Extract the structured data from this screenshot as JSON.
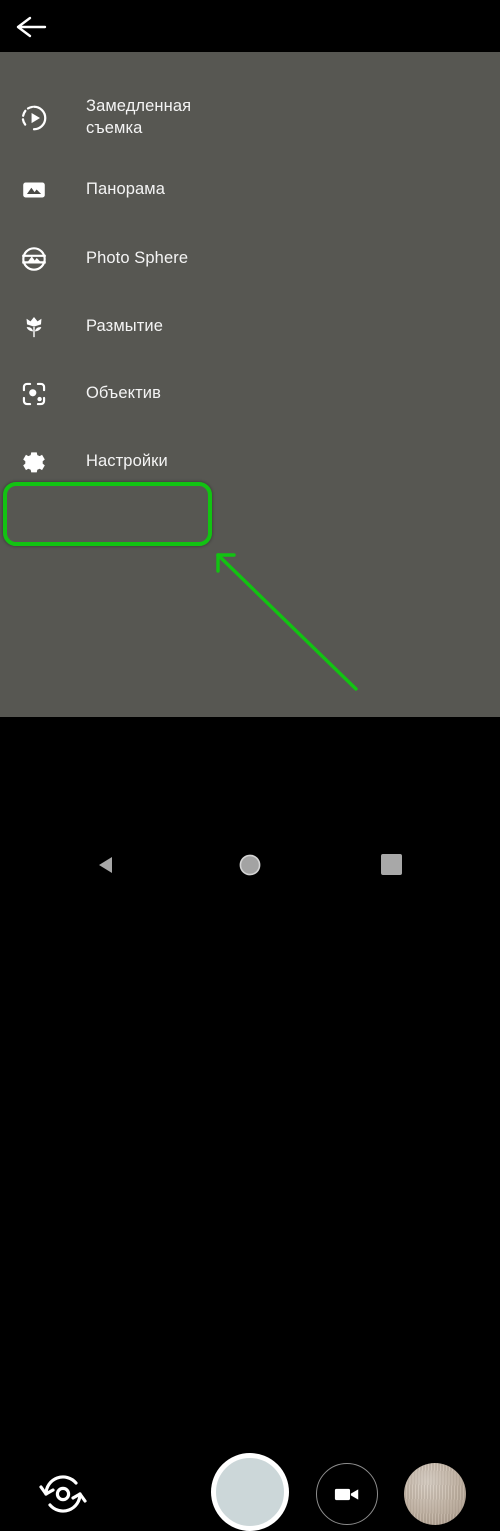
{
  "app": {
    "screen_title": "Camera mode menu",
    "background_color": "#575752",
    "accent_color": "#12c312"
  },
  "topbar": {
    "back_icon": "arrow-left-icon",
    "background_color": "#000000"
  },
  "mode_menu": {
    "items": [
      {
        "label": "Замедленная\nсъемка",
        "icon": "slow-motion-icon",
        "name": "slow-motion",
        "selected": false
      },
      {
        "label": "Панорама",
        "icon": "panorama-icon",
        "name": "panorama",
        "selected": false
      },
      {
        "label": "Photo Sphere",
        "icon": "photo-sphere-icon",
        "name": "photo-sphere",
        "selected": false
      },
      {
        "label": "Размытие",
        "icon": "flower-icon",
        "name": "blur",
        "selected": false
      },
      {
        "label": "Объектив",
        "icon": "lens-icon",
        "name": "lens",
        "selected": false
      },
      {
        "label": "Настройки",
        "icon": "gear-icon",
        "name": "settings",
        "selected": true
      }
    ]
  },
  "annotation": {
    "highlight_target": "Настройки",
    "highlight_color": "#12c312",
    "arrow_icon": "arrow-up-left-icon"
  },
  "camera_bar": {
    "flip_camera_icon": "switch-camera-icon",
    "shutter_label": "shutter-button",
    "shutter_fill_color": "#ccd7d9",
    "video_mode_icon": "videocam-icon",
    "gallery_thumbnail": "last-photo-thumbnail"
  },
  "nav_bar": {
    "back_icon": "nav-back-triangle-icon",
    "home_icon": "nav-home-circle-icon",
    "recents_icon": "nav-recents-square-icon",
    "icon_color": "#a8a8a8"
  }
}
